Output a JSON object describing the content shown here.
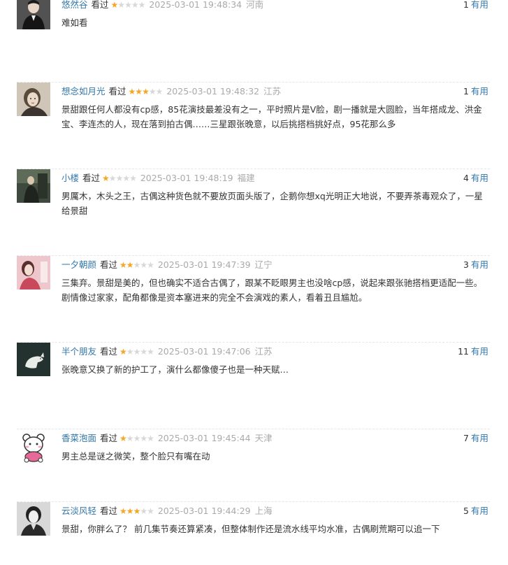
{
  "comments": [
    {
      "user": "悠然谷",
      "rated_label": "看过",
      "rating": 1,
      "time": "2025-03-01 19:48:34",
      "location": "河南",
      "votes": "1",
      "useful_label": "有用",
      "text": "难如看",
      "avatar": "avatar-man-dark-suit"
    },
    {
      "user": "想念如月光",
      "rated_label": "看过",
      "rating": 3,
      "time": "2025-03-01 19:48:32",
      "location": "江苏",
      "votes": "1",
      "useful_label": "有用",
      "text": "景甜跟任何人都没有cp感，85花演技最差没有之一，平时照片是V脸，剧一播就是大圆脸，当年搭成龙、洪金宝、李连杰的人，现在落到拍古偶……三星跟张晚意，以后挑搭档挑好点，95花那么多",
      "avatar": "avatar-woman-vintage"
    },
    {
      "user": "小楼",
      "rated_label": "看过",
      "rating": 1,
      "time": "2025-03-01 19:48:19",
      "location": "福建",
      "votes": "4",
      "useful_label": "有用",
      "text": "男厲木，木头之王，古偶这种货色就不要放页面头版了，企鹅你想xq光明正大地说，不要弄茶毒观众了，一星给景甜",
      "avatar": "avatar-figure-green"
    },
    {
      "user": "一夕朝颜",
      "rated_label": "看过",
      "rating": 2,
      "time": "2025-03-01 19:47:39",
      "location": "辽宁",
      "votes": "3",
      "useful_label": "有用",
      "text": "三集弃。景甜是美的，但也确实不适合古偶了，跟某不眨眼男主也没啥cp感，说起来跟张驰搭档更适配一些。剧情像过家家，配角都像是资本塞进来的完全不会演戏的素人，看着丑且尴尬。",
      "avatar": "avatar-woman-pink"
    },
    {
      "user": "半个朋友",
      "rated_label": "看过",
      "rating": 1,
      "time": "2025-03-01 19:47:06",
      "location": "江苏",
      "votes": "11",
      "useful_label": "有用",
      "text": "张晚意又换了新的护工了，演什么都像傻子也是一种天赋…",
      "avatar": "avatar-white-animal"
    },
    {
      "user": "香菜泡面",
      "rated_label": "看过",
      "rating": 1,
      "time": "2025-03-01 19:45:44",
      "location": "天津",
      "votes": "7",
      "useful_label": "有用",
      "text": "男主总是谜之微笑，整个脸只有嘴在动",
      "avatar": "avatar-cartoon-bear"
    },
    {
      "user": "云淡风轻",
      "rated_label": "看过",
      "rating": 3,
      "time": "2025-03-01 19:44:29",
      "location": "上海",
      "votes": "5",
      "useful_label": "有用",
      "text": "景甜，你胖么了？ 前几集节奏还算紧凑，但整体制作还是流水线平均水准，古偶刷荒期可以追一下",
      "avatar": "avatar-woman-bw"
    }
  ]
}
